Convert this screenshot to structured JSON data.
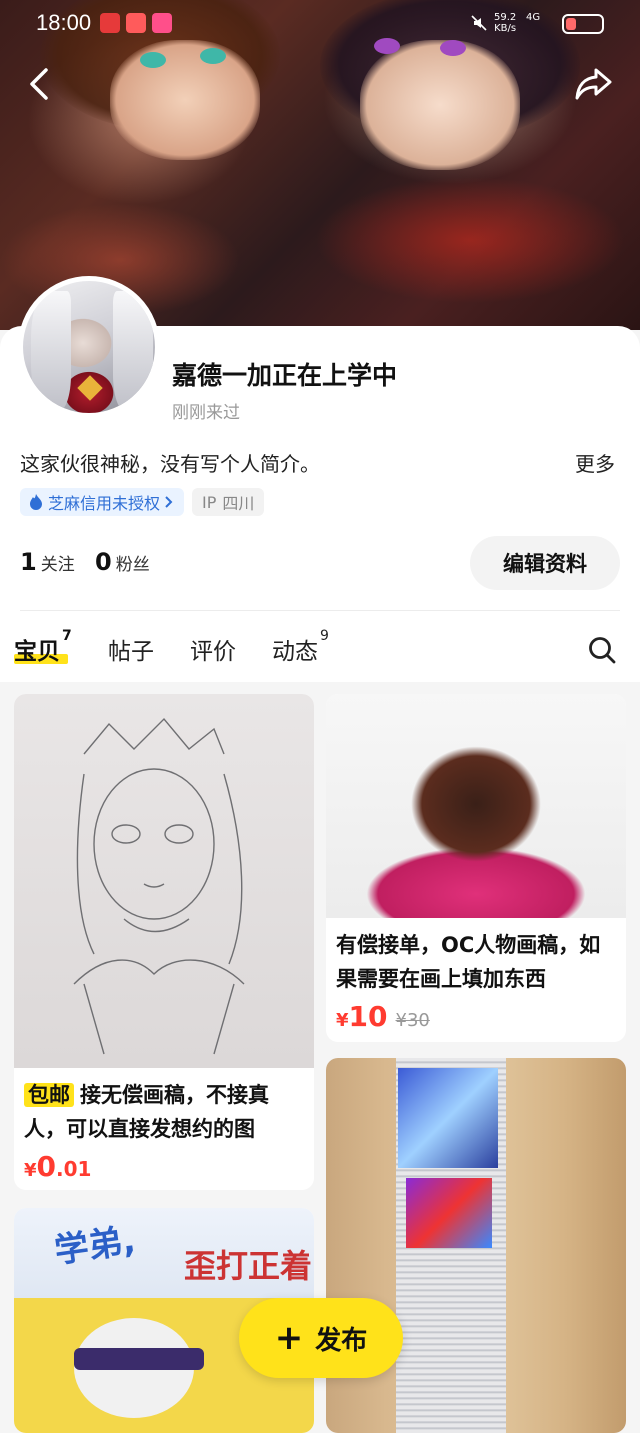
{
  "status_bar": {
    "time": "18:00",
    "net_speed": "59.2",
    "net_unit": "KB/s",
    "signal": "4G",
    "battery_color": "#ff6a6a"
  },
  "header": {
    "back_icon": "chevron-left-icon",
    "share_icon": "share-icon"
  },
  "profile": {
    "nickname": "嘉德一加正在上学中",
    "last_seen": "刚刚来过",
    "bio": "这家伙很神秘，没有写个人简介。",
    "more_label": "更多",
    "credit_badge": "芝麻信用未授权",
    "ip_label": "IP",
    "ip_location": "四川",
    "following_count": "1",
    "following_label": "关注",
    "followers_count": "0",
    "followers_label": "粉丝",
    "edit_button": "编辑资料"
  },
  "tabs": [
    {
      "label": "宝贝",
      "count": "7"
    },
    {
      "label": "帖子",
      "count": ""
    },
    {
      "label": "评价",
      "count": ""
    },
    {
      "label": "动态",
      "count": "9"
    }
  ],
  "items": [
    {
      "tag": "包邮",
      "title": "接无偿画稿，不接真人，可以直接发想约的图",
      "currency": "¥",
      "price_int": "0",
      "price_dec": ".01",
      "original_price": ""
    },
    {
      "tag": "",
      "title": "有偿接单，OC人物画稿，如果需要在画上填加东西",
      "currency": "¥",
      "price_int": "10",
      "price_dec": "",
      "original_price": "¥30"
    },
    {
      "cover_text_1": "学弟,",
      "cover_text_2": "歪打正着"
    }
  ],
  "publish_button": "发布",
  "colors": {
    "accent_yellow": "#ffe21a",
    "price_red": "#ff3b30",
    "link_blue": "#2f6fd6"
  }
}
